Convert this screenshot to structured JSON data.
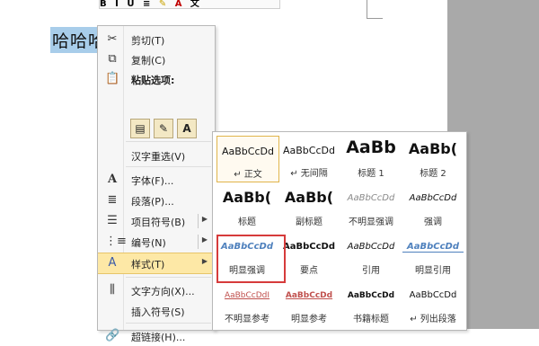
{
  "document": {
    "text": "哈哈哈"
  },
  "mini_toolbar": {
    "items": [
      "B",
      "I",
      "U",
      "≡",
      "✎",
      "A",
      "文"
    ]
  },
  "context_menu": {
    "cut": "剪切(T)",
    "copy": "复制(C)",
    "paste_options": "粘贴选项:",
    "paste_buttons": [
      "A"
    ],
    "reconvert": "汉字重选(V)",
    "font": "字体(F)...",
    "paragraph": "段落(P)...",
    "bullets": "项目符号(B)",
    "numbering": "编号(N)",
    "styles": "样式(T)",
    "text_direction": "文字方向(X)...",
    "insert_symbol": "插入符号(S)",
    "hyperlink": "超链接(H)..."
  },
  "style_gallery": {
    "rows": [
      [
        {
          "preview": "AaBbCcDd",
          "name": "↵ 正文"
        },
        {
          "preview": "AaBbCcDd",
          "name": "↵ 无间隔"
        },
        {
          "preview": "AaBb",
          "name": "标题 1"
        },
        {
          "preview": "AaBb(",
          "name": "标题 2"
        }
      ],
      [
        {
          "preview": "AaBb(",
          "name": "标题"
        },
        {
          "preview": "AaBb(",
          "name": "副标题"
        },
        {
          "preview": "AaBbCcDd",
          "name": "不明显强调"
        },
        {
          "preview": "AaBbCcDd",
          "name": "强调"
        }
      ],
      [
        {
          "preview": "AaBbCcDd",
          "name": "明显强调"
        },
        {
          "preview": "AaBbCcDd",
          "name": "要点"
        },
        {
          "preview": "AaBbCcDd",
          "name": "引用"
        },
        {
          "preview": "AaBbCcDd",
          "name": "明显引用"
        }
      ],
      [
        {
          "preview": "AaBbCcDdI",
          "name": "不明显参考"
        },
        {
          "preview": "AaBbCcDd",
          "name": "明显参考"
        },
        {
          "preview": "AaBbCcDd",
          "name": "书籍标题"
        },
        {
          "preview": "AaBbCcDd",
          "name": "↵ 列出段落"
        }
      ]
    ]
  },
  "colors": {
    "highlight": "#fde8a6",
    "selection": "#a8cdea",
    "callout": "#d63b3b"
  }
}
